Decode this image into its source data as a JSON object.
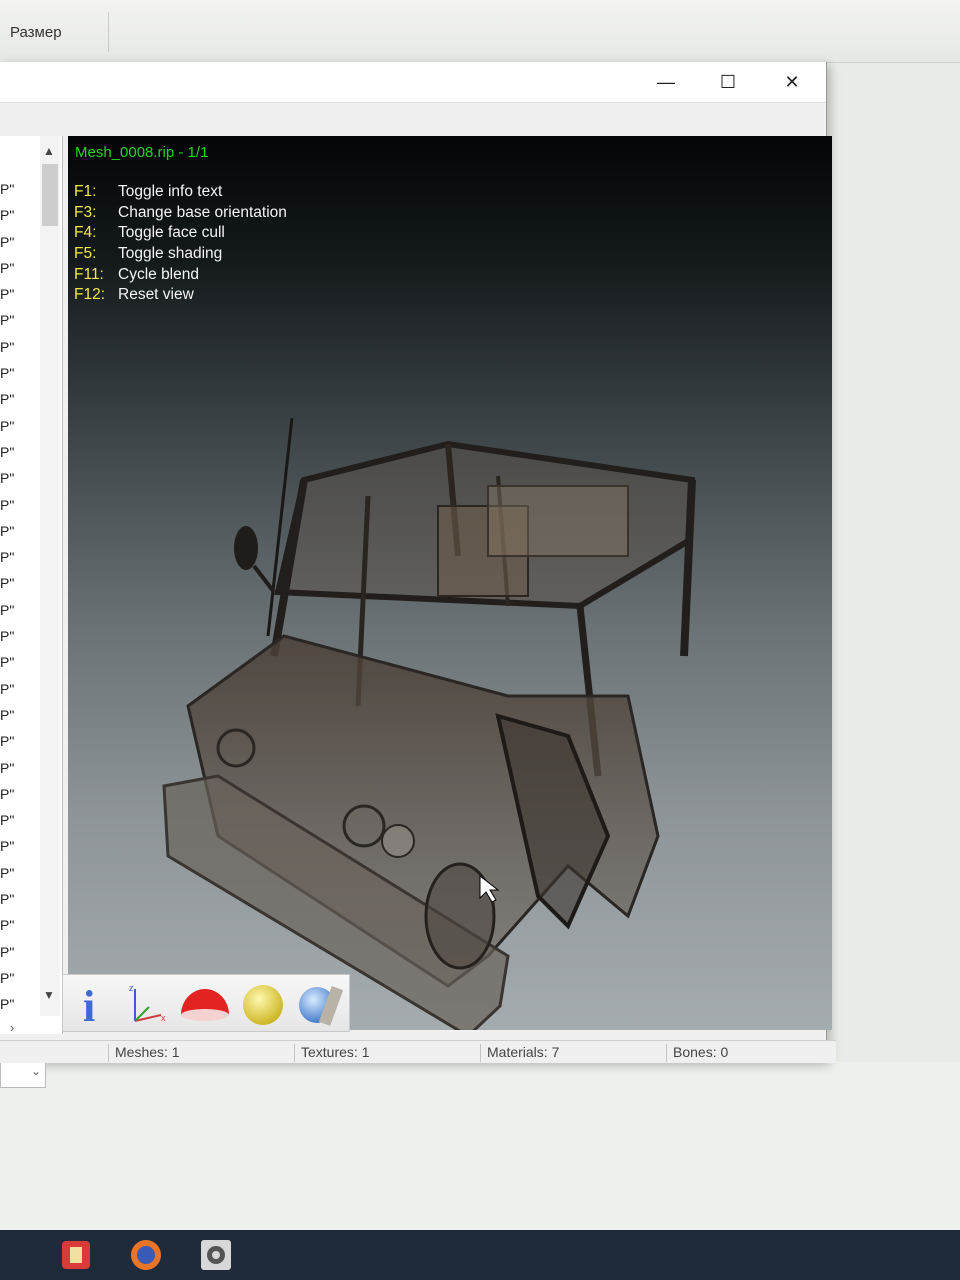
{
  "background": {
    "column_header": "Размер"
  },
  "window": {
    "controls": {
      "minimize": "—",
      "maximize": "☐",
      "close": "✕"
    }
  },
  "left_list": {
    "items": [
      "P\"",
      "P\"",
      "P\"",
      "P\"",
      "P\"",
      "P\"",
      "P\"",
      "P\"",
      "P\"",
      "P\"",
      "P\"",
      "P\"",
      "P\"",
      "P\"",
      "P\"",
      "P\"",
      "P\"",
      "P\"",
      "P\"",
      "P\"",
      "P\"",
      "P\"",
      "P\"",
      "P\"",
      "P\"",
      "P\"",
      "P\"",
      "P\"",
      "P\"",
      "P\"",
      "P\"",
      "P\""
    ],
    "scroll_up": "▲",
    "scroll_down": "▼",
    "scroll_right": "›",
    "combo_arrow": "⌄"
  },
  "viewport": {
    "title": "Mesh_0008.rip - 1/1",
    "shortcuts": [
      {
        "key": "F1:",
        "desc": "Toggle info text"
      },
      {
        "key": "F3:",
        "desc": "Change base orientation"
      },
      {
        "key": "F4:",
        "desc": "Toggle face cull"
      },
      {
        "key": "F5:",
        "desc": "Toggle shading"
      },
      {
        "key": "F11:",
        "desc": "Cycle blend"
      },
      {
        "key": "F12:",
        "desc": "Reset view"
      }
    ]
  },
  "toolbar": {
    "icons": [
      "info-icon",
      "axes-icon",
      "half-sphere-icon",
      "sphere-icon",
      "textured-sphere-icon"
    ],
    "info_glyph": "i"
  },
  "statusbar": {
    "meshes": "Meshes: 1",
    "textures": "Textures: 1",
    "materials": "Materials: 7",
    "bones": "Bones: 0"
  },
  "taskbar": {
    "apps": [
      "shield-app-icon",
      "firefox-icon",
      "settings-app-icon"
    ]
  }
}
